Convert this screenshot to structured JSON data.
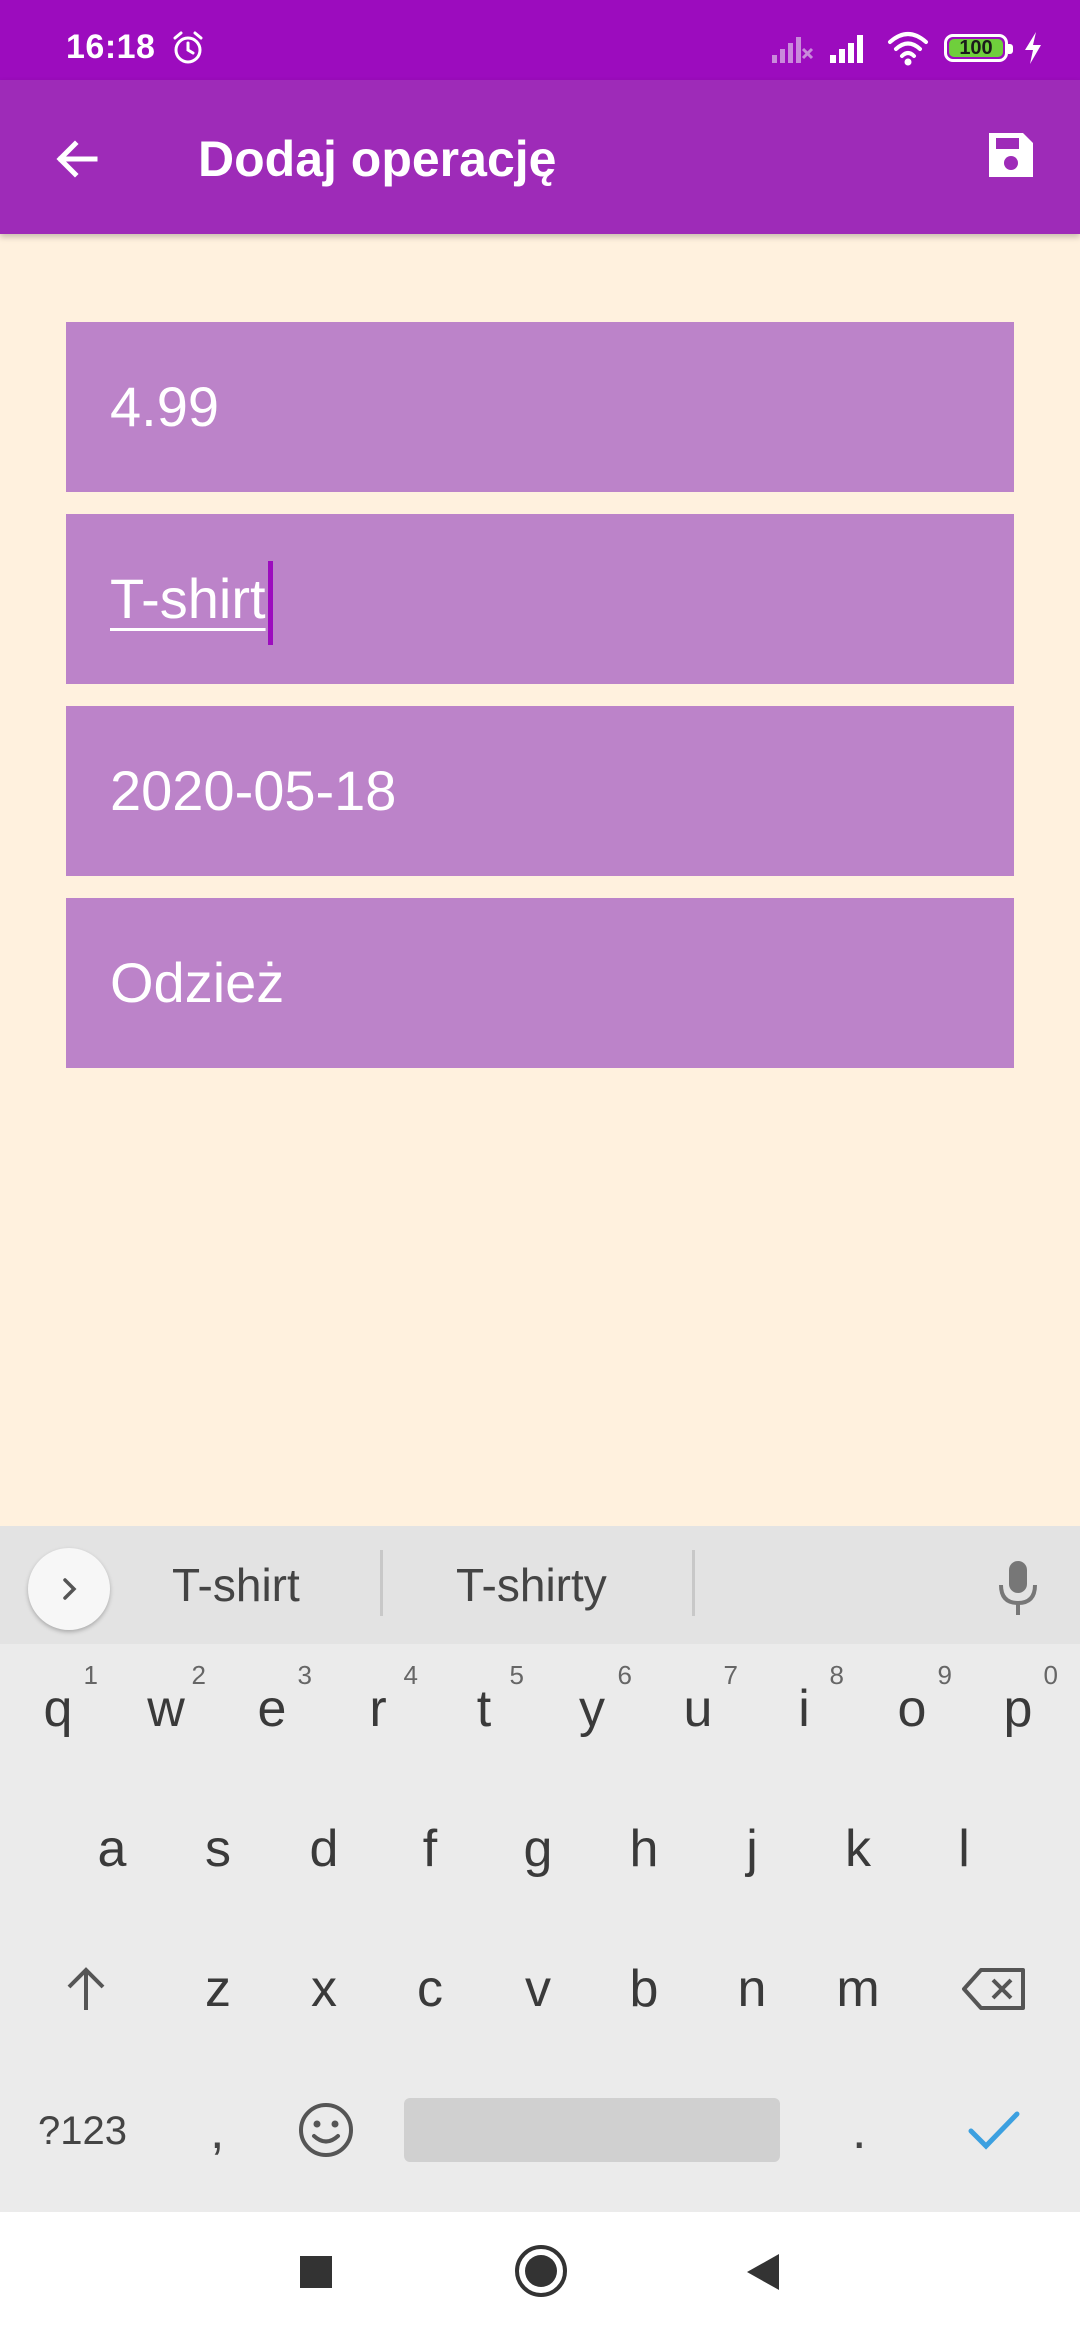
{
  "status_bar": {
    "time": "16:18",
    "battery_level": "100",
    "icons": [
      "alarm-icon",
      "no-signal-icon",
      "signal-icon",
      "wifi-icon",
      "battery-icon",
      "charging-icon"
    ]
  },
  "app_bar": {
    "title": "Dodaj operację",
    "back_icon": "arrow-left-icon",
    "save_icon": "save-icon",
    "color": "#9E2BB8"
  },
  "form": {
    "amount": "4.99",
    "name": "T-shirt",
    "date": "2020-05-18",
    "category": "Odzież",
    "field_color": "#BC83C9",
    "background": "#FFF1DE"
  },
  "keyboard": {
    "suggestions": [
      "T-shirt",
      "T-shirty"
    ],
    "row1": [
      {
        "key": "q",
        "hint": "1"
      },
      {
        "key": "w",
        "hint": "2"
      },
      {
        "key": "e",
        "hint": "3"
      },
      {
        "key": "r",
        "hint": "4"
      },
      {
        "key": "t",
        "hint": "5"
      },
      {
        "key": "y",
        "hint": "6"
      },
      {
        "key": "u",
        "hint": "7"
      },
      {
        "key": "i",
        "hint": "8"
      },
      {
        "key": "o",
        "hint": "9"
      },
      {
        "key": "p",
        "hint": "0"
      }
    ],
    "row2": [
      "a",
      "s",
      "d",
      "f",
      "g",
      "h",
      "j",
      "k",
      "l"
    ],
    "row3": [
      "z",
      "x",
      "c",
      "v",
      "b",
      "n",
      "m"
    ],
    "symbols_label": "?123",
    "comma": ",",
    "period": "."
  },
  "nav_bar": {
    "icons": [
      "recents-icon",
      "home-icon",
      "back-icon"
    ]
  }
}
